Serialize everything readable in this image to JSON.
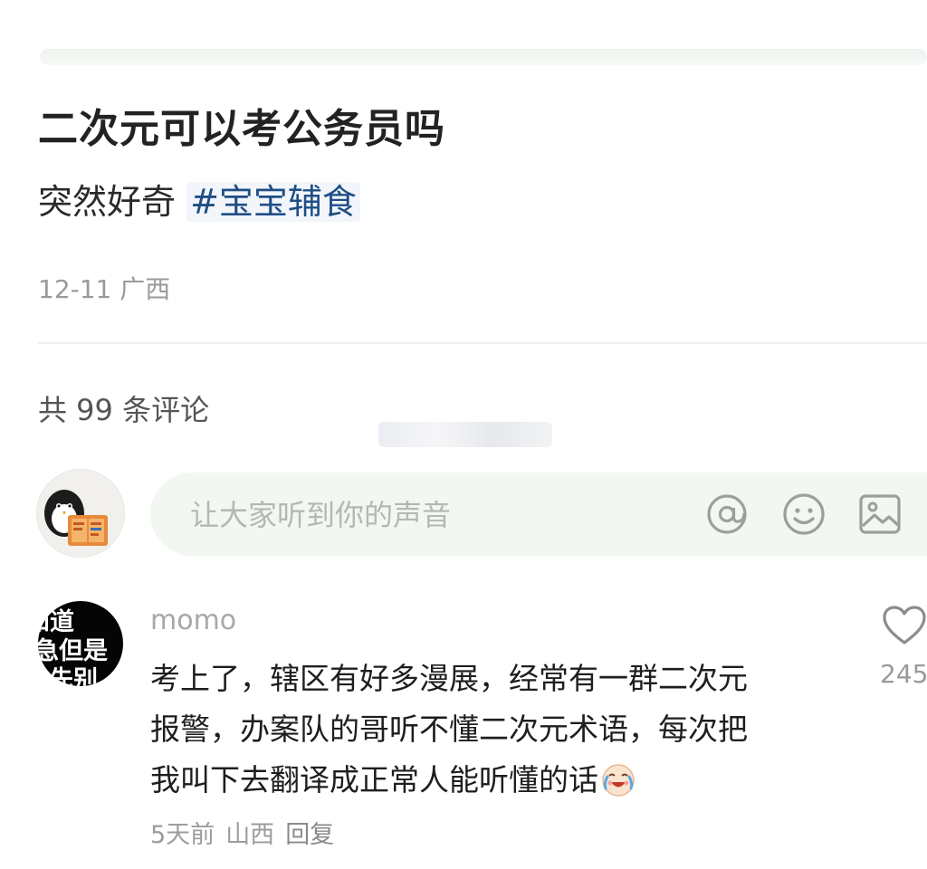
{
  "post": {
    "title": "二次元可以考公务员吗",
    "body_text": "突然好奇 ",
    "hashtag": "#宝宝辅食",
    "date": "12-11",
    "location": "广西"
  },
  "comments_section": {
    "count_label": "共 99 条评论"
  },
  "composer": {
    "placeholder": "让大家听到你的声音",
    "icons": [
      "at-icon",
      "emoji-icon",
      "image-icon"
    ]
  },
  "comment": {
    "username": "momo",
    "avatar_text": [
      "知道",
      "急但是",
      "先别"
    ],
    "lines": [
      "考上了，辖区有好多漫展，经常有一群二次元",
      "报警，办案队的哥听不懂二次元术语，每次把",
      "我叫下去翻译成正常人能听懂的话"
    ],
    "emoji": "laughing-crying-face-icon",
    "time": "5天前",
    "location": "山西",
    "reply_label": "回复",
    "like_count": "245"
  },
  "colors": {
    "hashtag": "#1f4e86",
    "input_bg": "#f2f7f1",
    "meta_gray": "#9a9a9a"
  }
}
